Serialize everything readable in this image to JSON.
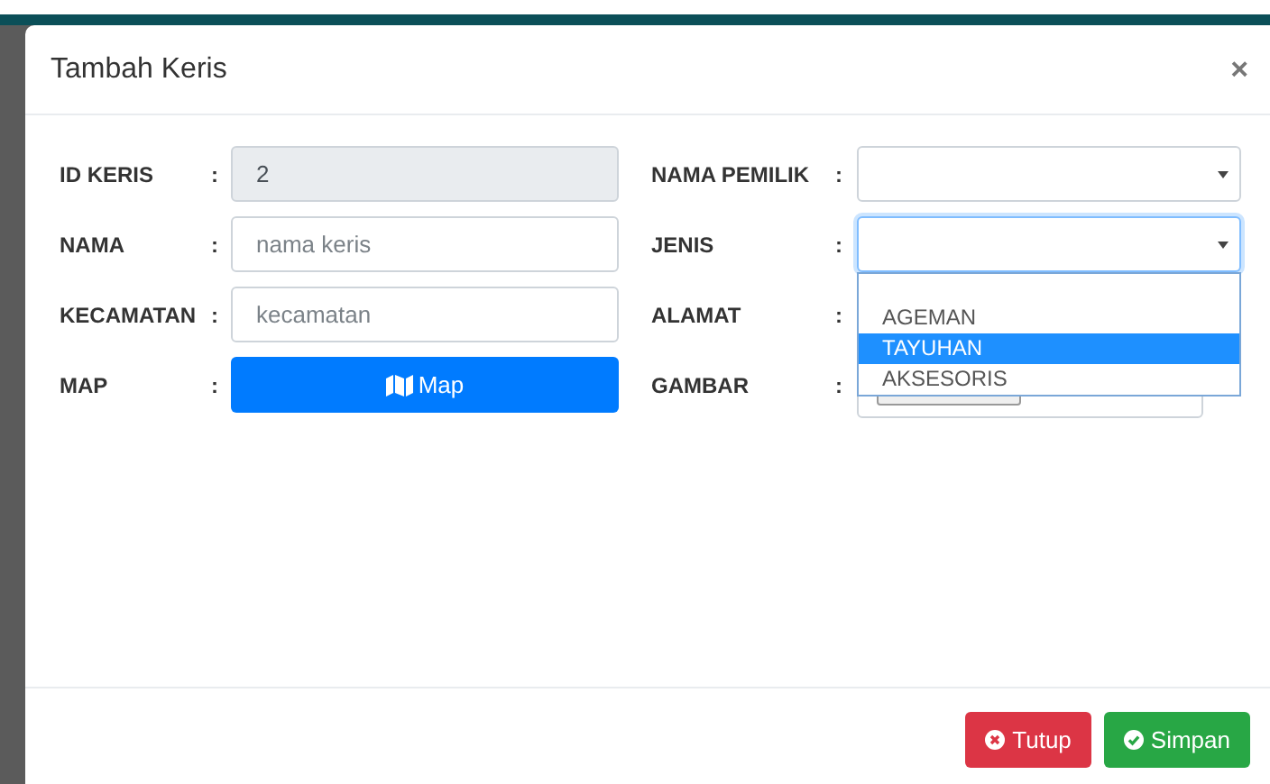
{
  "modal": {
    "title": "Tambah Keris",
    "close": "×"
  },
  "left_fields": [
    {
      "label": "ID KERIS",
      "colon": ":",
      "kind": "readonly",
      "value": "2"
    },
    {
      "label": "NAMA",
      "colon": ":",
      "kind": "text",
      "placeholder": "nama keris"
    },
    {
      "label": "KECAMATAN",
      "colon": ":",
      "kind": "text",
      "placeholder": "kecamatan"
    },
    {
      "label": "MAP",
      "colon": ":",
      "kind": "button",
      "value": "Map"
    }
  ],
  "right_fields": [
    {
      "label": "NAMA PEMILIK",
      "colon": ":",
      "kind": "select",
      "focused": false
    },
    {
      "label": "JENIS",
      "colon": ":",
      "kind": "select",
      "focused": true,
      "options": [
        {
          "label": "AGEMAN",
          "selected": false
        },
        {
          "label": "TAYUHAN",
          "selected": true
        },
        {
          "label": "AKSESORIS",
          "selected": false
        }
      ]
    },
    {
      "label": "ALAMAT",
      "colon": ":",
      "kind": "hidden"
    },
    {
      "label": "GAMBAR",
      "colon": ":",
      "kind": "file"
    }
  ],
  "footer_buttons": [
    {
      "label": "Tutup",
      "kind": "danger"
    },
    {
      "label": "Simpan",
      "kind": "success"
    }
  ]
}
